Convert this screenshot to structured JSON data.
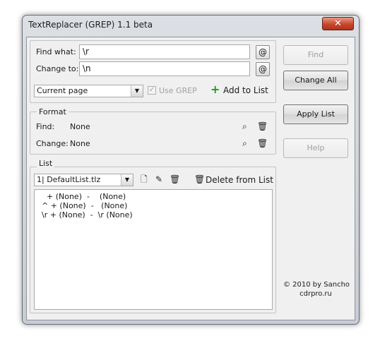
{
  "window": {
    "title": "TextReplacer (GREP) 1.1 beta",
    "close_glyph": "✕"
  },
  "find_box": {
    "find_label": "Find what:",
    "find_value": "\\r",
    "change_label": "Change to:",
    "change_value": "\\n",
    "at_glyph": "@",
    "scope_value": "Current page",
    "use_grep_label": "Use GREP",
    "use_grep_checked": true,
    "add_to_list_label": "Add to List"
  },
  "format": {
    "legend": "Format",
    "find_label": "Find:",
    "find_value": "None",
    "change_label": "Change:",
    "change_value": "None"
  },
  "list": {
    "legend": "List",
    "file_value": "1| DefaultList.tlz",
    "delete_label": "Delete from List",
    "items": [
      "  + (None)  -    (None)",
      "^ + (None)  -   (None)",
      "\\r + (None)  -  \\r (None)"
    ]
  },
  "buttons": {
    "find": "Find",
    "change_all": "Change All",
    "apply_list": "Apply List",
    "help": "Help"
  },
  "credits": {
    "line1": "© 2010 by Sancho",
    "line2": "cdrpro.ru"
  },
  "colors": {
    "window_bg": "#f0f0f0",
    "close_red": "#c8462c",
    "add_green": "#1f9a1f"
  },
  "icons": [
    "close-icon",
    "at-icon",
    "dropdown-arrow-icon",
    "checkbox-icon",
    "plus-icon",
    "search-format-icon",
    "trash-icon",
    "new-file-icon",
    "edit-file-icon"
  ]
}
